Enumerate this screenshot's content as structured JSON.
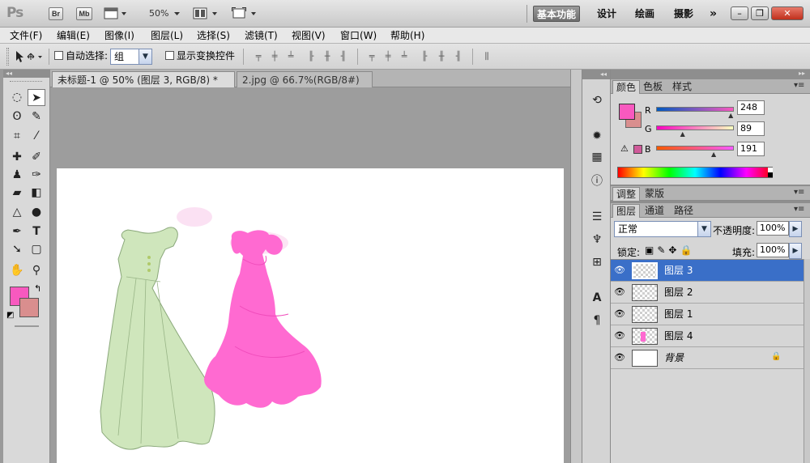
{
  "app": {
    "logo": "Ps",
    "bridge_label": "Br",
    "minibridge_label": "Mb",
    "zoom": "50%"
  },
  "workspace": {
    "items": [
      "基本功能",
      "设计",
      "绘画",
      "摄影"
    ],
    "active": "基本功能",
    "more": "»"
  },
  "window_controls": {
    "minimize": "–",
    "restore": "❐",
    "close": "✕"
  },
  "menubar": {
    "items": [
      "文件(F)",
      "编辑(E)",
      "图像(I)",
      "图层(L)",
      "选择(S)",
      "滤镜(T)",
      "视图(V)",
      "窗口(W)",
      "帮助(H)"
    ]
  },
  "options": {
    "auto_select_label": "自动选择:",
    "auto_select_value": "组",
    "show_transform_label": "显示变换控件"
  },
  "tabs": [
    {
      "label": "未标题-1 @ 50% (图层 3, RGB/8) *",
      "active": true
    },
    {
      "label": "2.jpg @ 66.7%(RGB/8#)",
      "active": false
    }
  ],
  "color_panel": {
    "tabs": [
      "颜色",
      "色板",
      "样式"
    ],
    "r_label": "R",
    "g_label": "G",
    "b_label": "B",
    "r": "248",
    "g": "89",
    "b": "191",
    "r_level": 0.97,
    "g_level": 0.35,
    "b_level": 0.75,
    "foreground": "#f859bf",
    "background": "#d98e8e"
  },
  "adjust_panel": {
    "tabs": [
      "调整",
      "蒙版"
    ]
  },
  "layers_panel": {
    "tabs": [
      "图层",
      "通道",
      "路径"
    ],
    "blend_mode": "正常",
    "opacity_label": "不透明度:",
    "opacity": "100%",
    "lock_label": "锁定:",
    "fill_label": "填充:",
    "fill": "100%",
    "layers": [
      {
        "name": "图层 3",
        "selected": true
      },
      {
        "name": "图层 2",
        "selected": false
      },
      {
        "name": "图层 1",
        "selected": false
      },
      {
        "name": "图层 4",
        "selected": false
      },
      {
        "name": "背景",
        "selected": false,
        "locked": true
      }
    ]
  },
  "colors": {
    "accent": "#3a6fc8",
    "dress_green": "#c9e4b4",
    "dress_pink": "#ff6ad1"
  }
}
